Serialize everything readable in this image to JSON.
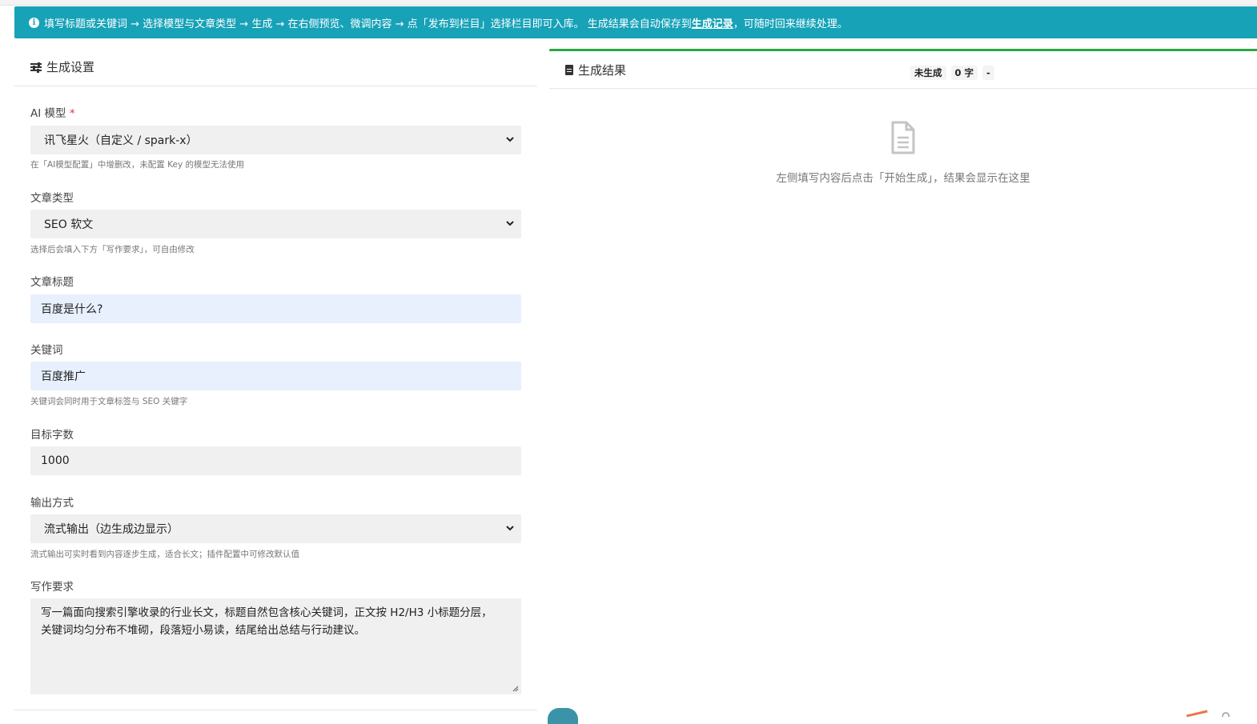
{
  "alert": {
    "text_before": "填写标题或关键词 → 选择模型与文章类型 → 生成 → 在右侧预览、微调内容 → 点「发布到栏目」选择栏目即可入库。 生成结果会自动保存到",
    "link": "生成记录",
    "text_after": "，可随时回来继续处理。"
  },
  "settings": {
    "title": "生成设置",
    "model": {
      "label": "AI 模型",
      "required_mark": "*",
      "selected": "讯飞星火（自定义 / spark-x）",
      "help": "在「AI模型配置」中增删改，未配置 Key 的模型无法使用"
    },
    "article_type": {
      "label": "文章类型",
      "selected": "SEO 软文",
      "help": "选择后会填入下方「写作要求」，可自由修改"
    },
    "article_title": {
      "label": "文章标题",
      "value": "百度是什么?"
    },
    "keywords": {
      "label": "关键词",
      "value": "百度推广",
      "help": "关键词会同时用于文章标签与 SEO 关键字"
    },
    "word_count": {
      "label": "目标字数",
      "value": "1000"
    },
    "output_mode": {
      "label": "输出方式",
      "selected": "流式输出（边生成边显示）",
      "help": "流式输出可实时看到内容逐步生成，适合长文；插件配置中可修改默认值"
    },
    "requirements": {
      "label": "写作要求",
      "line1": "写一篇面向搜索引擎收录的行业长文，标题自然包含核心关键词，正文按 H2/H3 小标题分层，",
      "line2": "关键词均匀分布不堆砌，段落短小易读，结尾给出总结与行动建议。"
    }
  },
  "result": {
    "title": "生成结果",
    "status": "未生成",
    "word_count": "0 字",
    "extra": "-",
    "empty_message": "左侧填写内容后点击「开始生成」，结果会显示在这里"
  },
  "colors": {
    "alert_bg": "#17a2b8",
    "result_topbar": "#28a745",
    "input_filled": "#e8f0fe",
    "required": "#dc3545"
  },
  "icons": [
    "info-icon",
    "sliders-icon",
    "chevron-down-icon",
    "file-icon",
    "document-icon"
  ]
}
